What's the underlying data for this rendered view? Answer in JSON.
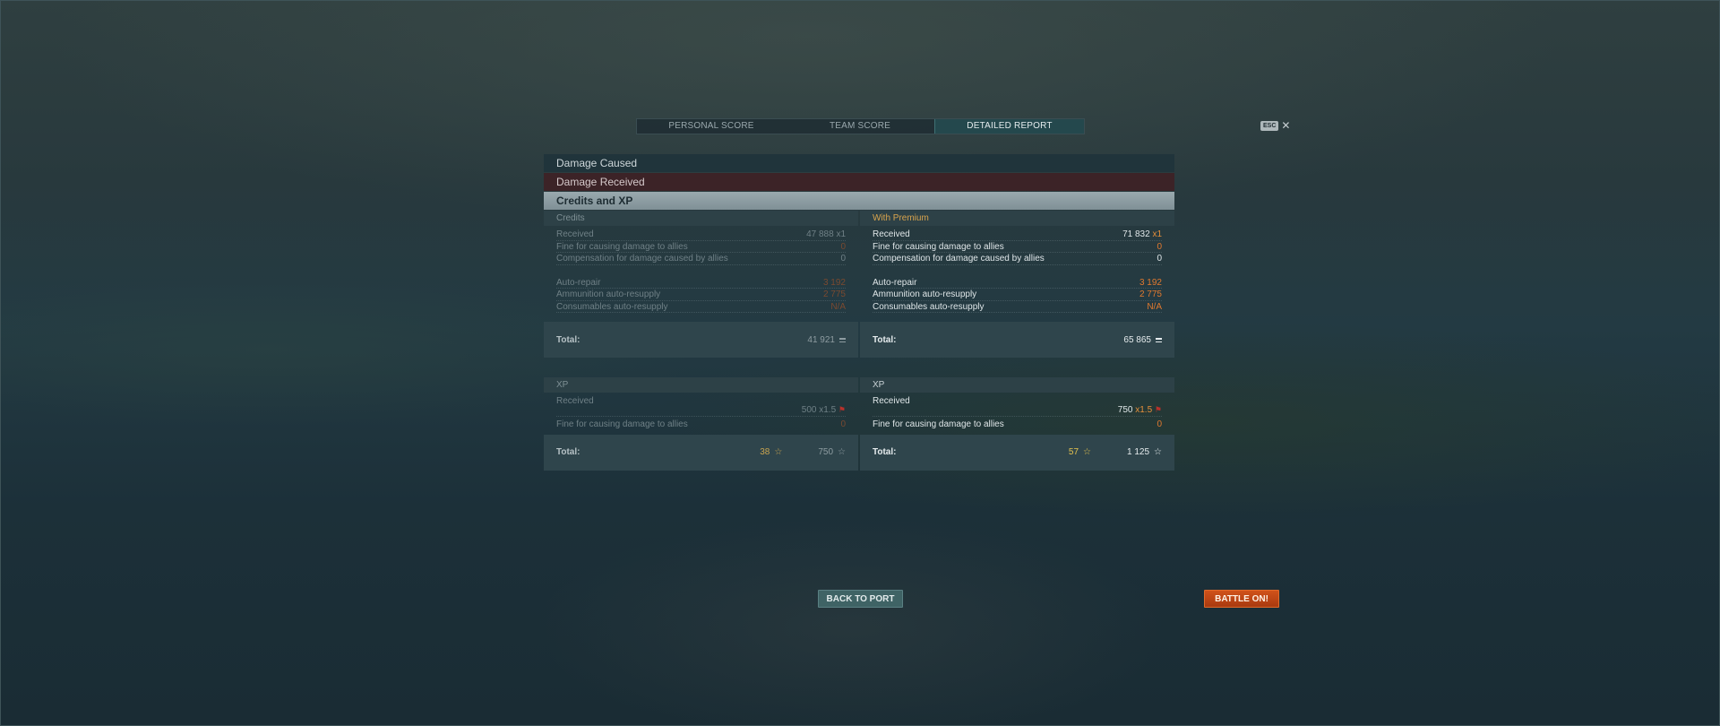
{
  "tabs": [
    {
      "label": "PERSONAL SCORE",
      "active": false
    },
    {
      "label": "TEAM SCORE",
      "active": false
    },
    {
      "label": "DETAILED REPORT",
      "active": true
    }
  ],
  "esc": {
    "badge": "ESC",
    "close_glyph": "✕"
  },
  "sections": {
    "damage_caused": "Damage Caused",
    "damage_received": "Damage Received",
    "credits_xp": "Credits and XP"
  },
  "credits": {
    "basic": {
      "header": "Credits",
      "rows": [
        {
          "label": "Received",
          "value": "47 888",
          "mult": "x1"
        },
        {
          "label": "Fine for causing damage to allies",
          "value": "0"
        },
        {
          "label": "Compensation for damage caused by allies",
          "value": "0"
        },
        {
          "label": "Auto-repair",
          "value": "3 192"
        },
        {
          "label": "Ammunition auto-resupply",
          "value": "2 775"
        },
        {
          "label": "Consumables auto-resupply",
          "value": "N/A"
        }
      ],
      "total_label": "Total:",
      "total_value": "41 921"
    },
    "premium": {
      "header": "With Premium",
      "rows": [
        {
          "label": "Received",
          "value": "71 832",
          "mult": "x1"
        },
        {
          "label": "Fine for causing damage to allies",
          "value": "0"
        },
        {
          "label": "Compensation for damage caused by allies",
          "value": "0"
        },
        {
          "label": "Auto-repair",
          "value": "3 192"
        },
        {
          "label": "Ammunition auto-resupply",
          "value": "2 775"
        },
        {
          "label": "Consumables auto-resupply",
          "value": "N/A"
        }
      ],
      "total_label": "Total:",
      "total_value": "65 865"
    }
  },
  "xp": {
    "basic": {
      "header": "XP",
      "received_label": "Received",
      "received_value": "500",
      "received_mult": "x1.5",
      "fine_label": "Fine for causing damage to allies",
      "fine_value": "0",
      "total_label": "Total:",
      "total_free": "38",
      "total_xp": "750"
    },
    "premium": {
      "header": "XP",
      "received_label": "Received",
      "received_value": "750",
      "received_mult": "x1.5",
      "fine_label": "Fine for causing damage to allies",
      "fine_value": "0",
      "total_label": "Total:",
      "total_free": "57",
      "total_xp": "1 125"
    }
  },
  "buttons": {
    "back_to_port": "BACK TO PORT",
    "battle_on": "BATTLE ON!"
  },
  "icons": {
    "credit": "coin-icon",
    "xp": "star-icon",
    "flag": "flag-icon"
  },
  "colors": {
    "accent_premium": "#d9a44d",
    "negative": "#e0792f",
    "battle": "#c64a16"
  }
}
